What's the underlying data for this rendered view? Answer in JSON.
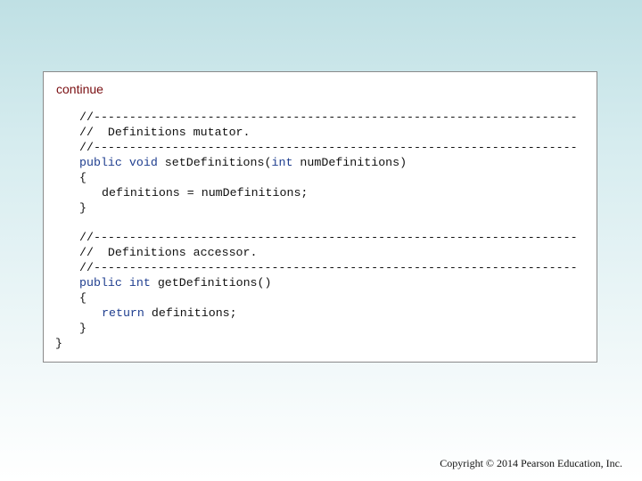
{
  "slide": {
    "continue_label": "continue",
    "copyright": "Copyright © 2014 Pearson Education, Inc."
  },
  "code": {
    "line1": "//--------------------------------------------------------------------",
    "line2": "//  Definitions mutator.",
    "line3": "//--------------------------------------------------------------------",
    "line4": {
      "kw_public": "public",
      "kw_void": "void",
      "method": "setDefinitions(",
      "kw_int": "int",
      "param": "numDefinitions)"
    },
    "line5": "{",
    "line6": "definitions = numDefinitions;",
    "line7": "}",
    "line8": "//--------------------------------------------------------------------",
    "line9": "//  Definitions accessor.",
    "line10": "//--------------------------------------------------------------------",
    "line11": {
      "kw_public": "public",
      "kw_int": "int",
      "method": "getDefinitions()"
    },
    "line12": "{",
    "line13": {
      "kw_return": "return",
      "rest": "definitions;"
    },
    "line14": "}",
    "line15": "}"
  }
}
